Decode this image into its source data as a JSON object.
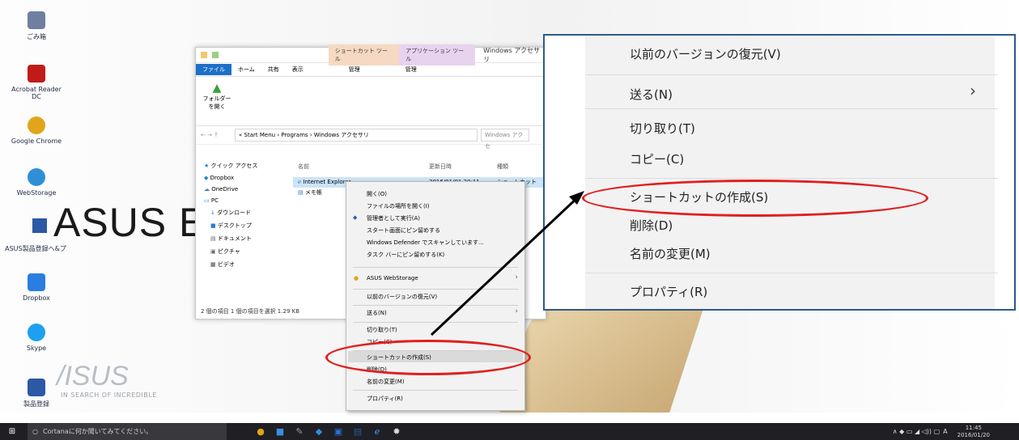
{
  "desktop": {
    "icons": [
      {
        "label": "ごみ箱",
        "icon": "recycle-bin-icon",
        "color": "#6f7fa0"
      },
      {
        "label": "Acrobat Reader DC",
        "icon": "acrobat-icon",
        "color": "#c11b17"
      },
      {
        "label": "Google Chrome",
        "icon": "chrome-icon",
        "color": "#e0a51b"
      },
      {
        "label": "WebStorage",
        "icon": "webstorage-icon",
        "color": "#2f8fd6"
      },
      {
        "label": "ASUS製品登録へ&プ",
        "icon": "asus-register-icon",
        "color": "#3a6fb5"
      },
      {
        "label": "Dropbox",
        "icon": "dropbox-icon",
        "color": "#2a7de1"
      },
      {
        "label": "Skype",
        "icon": "skype-icon",
        "color": "#1da0f2"
      },
      {
        "label": "製品登録",
        "icon": "product-icon",
        "color": "#2c58a5"
      }
    ],
    "brand_text": "ASUS Eee",
    "asus_logo": "/ISUS",
    "tagline": "IN SEARCH OF INCREDIBLE"
  },
  "explorer": {
    "tabs": {
      "shortcut_tools": "ショートカット ツール",
      "app_tools": "アプリケーション ツール",
      "title": "Windows アクセサリ"
    },
    "ribbon_tabs": [
      "ファイル",
      "ホーム",
      "共有",
      "表示",
      "管理",
      "管理"
    ],
    "folder_button": "フォルダー を開く",
    "address": "« Start Menu › Programs › Windows アクセサリ",
    "search_placeholder": "Windows アクセ",
    "nav": [
      {
        "label": "クイック アクセス",
        "icon": "star-icon"
      },
      {
        "label": "Dropbox",
        "icon": "dropbox-icon"
      },
      {
        "label": "OneDrive",
        "icon": "onedrive-icon"
      },
      {
        "label": "PC",
        "icon": "pc-icon"
      },
      {
        "label": "ダウンロード",
        "icon": "download-icon"
      },
      {
        "label": "デスクトップ",
        "icon": "desktop-icon"
      },
      {
        "label": "ドキュメント",
        "icon": "document-icon"
      },
      {
        "label": "ピクチャ",
        "icon": "picture-icon"
      },
      {
        "label": "ビデオ",
        "icon": "video-icon"
      }
    ],
    "columns": {
      "name": "名前",
      "date": "更新日時",
      "type": "種類"
    },
    "files": [
      {
        "name": "Internet Explorer",
        "date": "2016/01/01 20:11",
        "type": "ショートカット"
      },
      {
        "name": "メモ帳",
        "date": "",
        "type": "トカット"
      }
    ],
    "status": "2 個の項目    1 個の項目を選択  1.29 KB"
  },
  "context_menu": {
    "items": [
      "開く(O)",
      "ファイルの場所を開く(I)",
      "管理者として実行(A)",
      "スタート画面にピン留めする",
      "Windows Defender でスキャンしています...",
      "タスク バーにピン留めする(K)",
      "ASUS WebStorage",
      "以前のバージョンの復元(V)",
      "送る(N)",
      "切り取り(T)",
      "コピー(C)",
      "ショートカットの作成(S)",
      "削除(D)",
      "名前の変更(M)",
      "プロパティ(R)"
    ]
  },
  "zoom_menu": {
    "items": [
      "以前のバージョンの復元(V)",
      "送る(N)",
      "切り取り(T)",
      "コピー(C)",
      "ショートカットの作成(S)",
      "削除(D)",
      "名前の変更(M)",
      "プロパティ(R)"
    ]
  },
  "taskbar": {
    "cortana_placeholder": "Cortanaに何か聞いてみてください。",
    "time": "11:45",
    "date": "2016/01/20",
    "ime": "A"
  },
  "colors": {
    "highlight_ring": "#e02020",
    "zoom_border": "#2e5a8a",
    "taskbar": "#1f1f24"
  }
}
